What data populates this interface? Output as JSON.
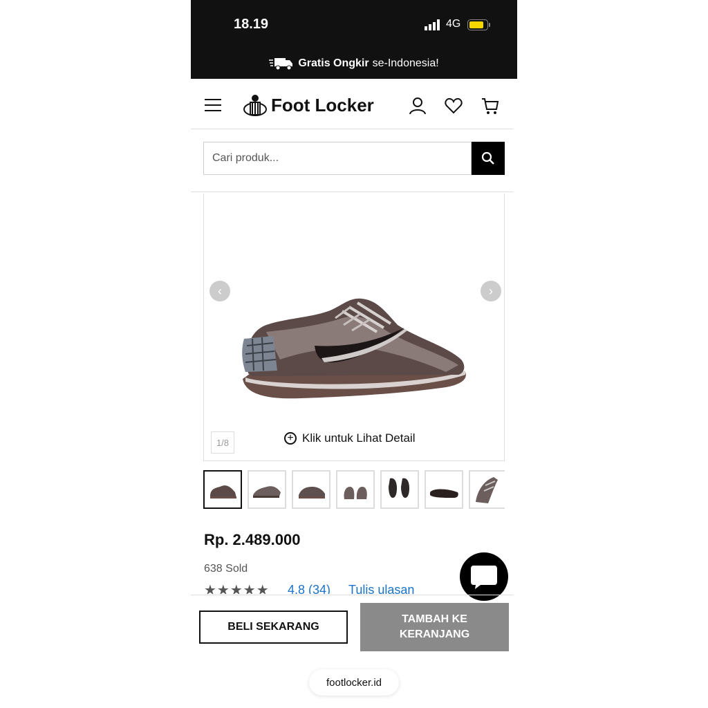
{
  "status_bar": {
    "time": "18.19",
    "network": "4G",
    "battery_color": "#f5d800"
  },
  "promo": {
    "bold": "Gratis Ongkir",
    "rest": "se-Indonesia!"
  },
  "header": {
    "logo_text": "Foot Locker"
  },
  "search": {
    "placeholder": "Cari produk..."
  },
  "gallery": {
    "counter": "1/8",
    "detail_label": "Klik untuk Lihat Detail",
    "thumbnail_count": 7
  },
  "product": {
    "price": "Rp. 2.489.000",
    "sold": "638 Sold",
    "rating_text": "4.8 (34)",
    "review_link": "Tulis ulasan",
    "stars": 5
  },
  "actions": {
    "buy_now": "BELI SEKARANG",
    "add_to_cart_line1": "TAMBAH KE",
    "add_to_cart_line2": "KERANJANG"
  },
  "browser": {
    "url": "footlocker.id"
  },
  "colors": {
    "dark": "#111111",
    "link": "#1a73c8",
    "cart_bg": "#8a8a8a"
  }
}
